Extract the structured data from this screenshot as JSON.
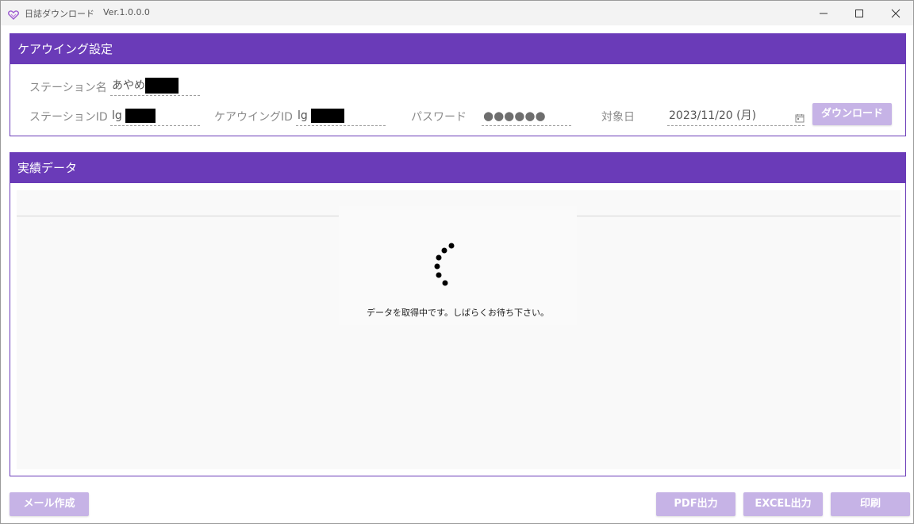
{
  "window": {
    "title": "日誌ダウンロード",
    "version": "Ver.1.0.0.0"
  },
  "settings": {
    "header": "ケアウイング設定",
    "station_name_label": "ステーション名",
    "station_name_value": "あやめ",
    "station_id_label": "ステーションID",
    "station_id_value": "lg",
    "carewing_id_label": "ケアウイングID",
    "carewing_id_value": "lg",
    "password_label": "パスワード",
    "password_value": "●●●●●●",
    "target_date_label": "対象日",
    "target_date_value": "2023/11/20 (月)",
    "download_label": "ダウンロード"
  },
  "results": {
    "header": "実績データ",
    "loading_text": "データを取得中です。しばらくお待ち下さい。"
  },
  "footer": {
    "mail_label": "メール作成",
    "pdf_label": "PDF出力",
    "excel_label": "EXCEL出力",
    "print_label": "印刷"
  },
  "colors": {
    "accent": "#6a3bb8",
    "button_disabled": "#c6b3e6"
  }
}
